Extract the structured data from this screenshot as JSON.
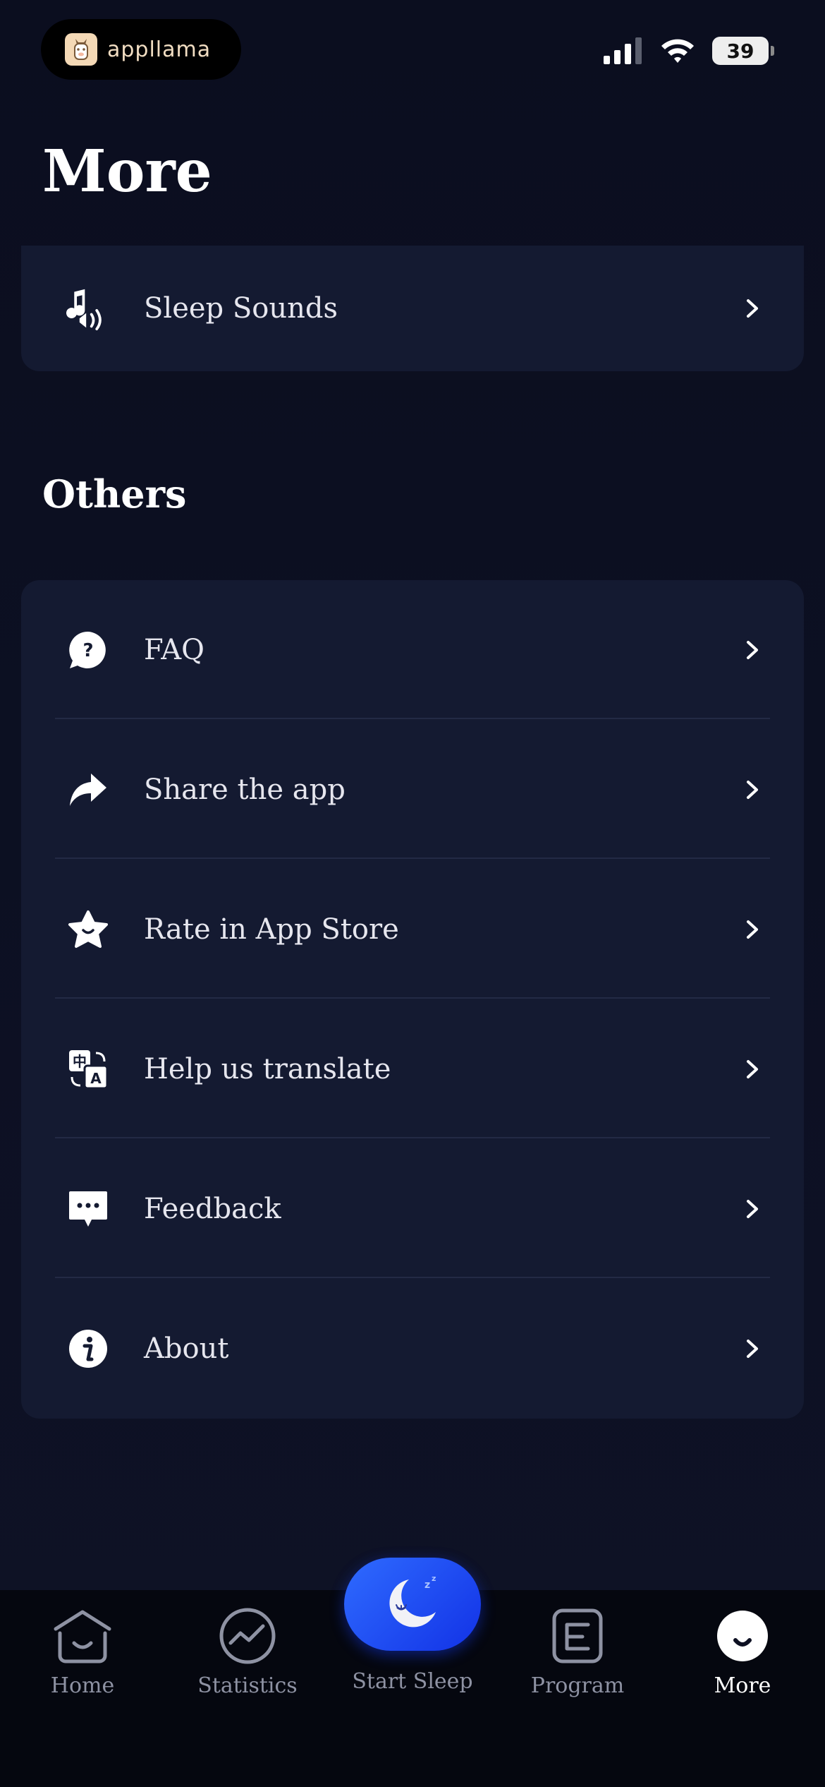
{
  "status_bar": {
    "brand_name": "appllama",
    "battery_level": "39",
    "signal_icon": "cellular-signal-icon",
    "wifi_icon": "wifi-icon"
  },
  "page": {
    "title": "More"
  },
  "top_card": {
    "items": [
      {
        "label": "Sleep Sounds",
        "icon": "music-speaker-icon"
      }
    ]
  },
  "others": {
    "title": "Others",
    "items": [
      {
        "label": "FAQ",
        "icon": "question-bubble-icon"
      },
      {
        "label": "Share the app",
        "icon": "share-arrow-icon"
      },
      {
        "label": "Rate in App Store",
        "icon": "star-icon"
      },
      {
        "label": "Help us translate",
        "icon": "translate-icon"
      },
      {
        "label": "Feedback",
        "icon": "chat-dots-icon"
      },
      {
        "label": "About",
        "icon": "info-icon"
      }
    ]
  },
  "tab_bar": {
    "tabs": [
      {
        "label": "Home",
        "icon": "home-smile-icon"
      },
      {
        "label": "Statistics",
        "icon": "chart-icon"
      },
      {
        "label": "Start Sleep",
        "icon": "moon-icon"
      },
      {
        "label": "Program",
        "icon": "program-icon"
      },
      {
        "label": "More",
        "icon": "more-face-icon"
      }
    ],
    "active": "More"
  },
  "colors": {
    "background": "#0d1022",
    "card": "#141a31",
    "accent_blue": "#1f4cff",
    "tab_inactive": "#8e92a3"
  }
}
